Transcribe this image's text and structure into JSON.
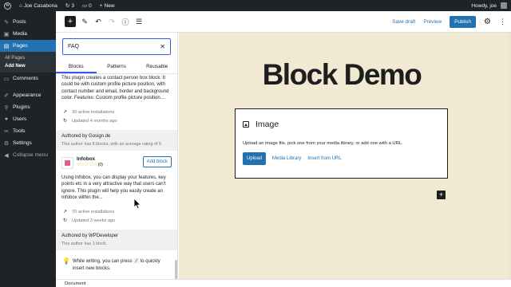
{
  "admin_bar": {
    "site_name": "Joe Casabona",
    "updates_count": "3",
    "comments_count": "0",
    "new_label": "New",
    "greeting": "Howdy, joe"
  },
  "admin_menu": {
    "items": [
      {
        "label": "Posts",
        "icon": "pushpin-icon"
      },
      {
        "label": "Media",
        "icon": "media-icon"
      },
      {
        "label": "Pages",
        "icon": "pages-icon"
      },
      {
        "label": "Comments",
        "icon": "comment-icon"
      },
      {
        "label": "Appearance",
        "icon": "brush-icon"
      },
      {
        "label": "Plugins",
        "icon": "plug-icon"
      },
      {
        "label": "Users",
        "icon": "user-icon"
      },
      {
        "label": "Tools",
        "icon": "wrench-icon"
      },
      {
        "label": "Settings",
        "icon": "settings-icon"
      }
    ],
    "submenu": [
      "All Pages",
      "Add New"
    ],
    "collapse_label": "Collapse menu"
  },
  "editor_header": {
    "save_draft": "Save draft",
    "preview": "Preview",
    "publish": "Publish"
  },
  "inserter": {
    "search_value": "FAQ",
    "tabs": [
      "Blocks",
      "Patterns",
      "Reusable"
    ],
    "active_tab": "Blocks",
    "result1": {
      "description": "This plugin creates a contact person box block. It could be with custom profile picture position, with contact number and email, border and background color. Features: Custom profile picture position....",
      "installs": "30 active installations",
      "updated": "Updated 4 months ago"
    },
    "author1": {
      "name": "Authored by Gosign.de",
      "info": "This author has 8 blocks, with an average rating of 5."
    },
    "result2": {
      "title": "Infobox",
      "stars": "☆☆☆☆☆",
      "rating_count": "(0)",
      "add_label": "Add block",
      "description": "Using Infobox, you can display your features, key points etc in a very attractive way that users can't ignore. This plugin will help you easily create an Infobox within the...",
      "installs": "70 active installations",
      "updated": "Updated 3 weeks ago"
    },
    "author2": {
      "name": "Authored by WPDeveloper",
      "info": "This author has 1 block."
    },
    "tip": {
      "before": "While writing, you can press",
      "key": "/",
      "after": "to quickly insert new blocks."
    }
  },
  "canvas": {
    "title": "Block Demo",
    "image_block": {
      "title": "Image",
      "instructions": "Upload an image file, pick one from your media library, or add one with a URL.",
      "upload": "Upload",
      "media_library": "Media Library",
      "insert_url": "Insert from URL"
    }
  },
  "footer": {
    "breadcrumb": "Document"
  },
  "colors": {
    "admin_dark": "#1d2327",
    "accent": "#2271b1",
    "canvas_bg": "#f1e9d2",
    "focus": "#3858e9"
  }
}
